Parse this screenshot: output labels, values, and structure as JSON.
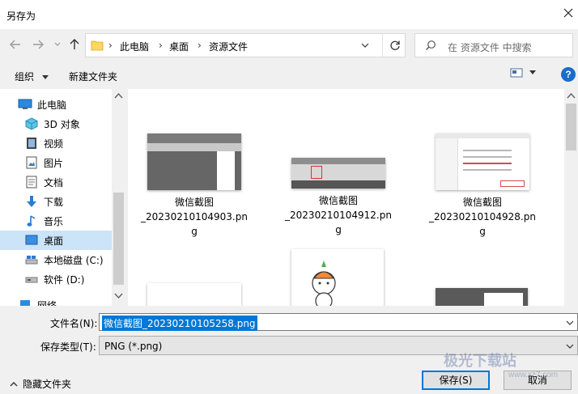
{
  "window": {
    "title": "另存为"
  },
  "address": {
    "crumbs": [
      "此电脑",
      "桌面",
      "资源文件"
    ]
  },
  "search": {
    "placeholder": "在 资源文件 中搜索"
  },
  "toolbar": {
    "organize": "组织",
    "new_folder": "新建文件夹",
    "help": "?"
  },
  "sidebar": {
    "items": [
      {
        "label": "此电脑",
        "icon": "computer-icon"
      },
      {
        "label": "3D 对象",
        "icon": "3d-objects-icon"
      },
      {
        "label": "视频",
        "icon": "video-icon"
      },
      {
        "label": "图片",
        "icon": "pictures-icon"
      },
      {
        "label": "文档",
        "icon": "documents-icon"
      },
      {
        "label": "下载",
        "icon": "download-icon"
      },
      {
        "label": "音乐",
        "icon": "music-icon"
      },
      {
        "label": "桌面",
        "icon": "desktop-icon",
        "selected": true
      },
      {
        "label": "本地磁盘 (C:)",
        "icon": "drive-c-icon"
      },
      {
        "label": "软件 (D:)",
        "icon": "drive-d-icon"
      },
      {
        "label": "网络",
        "icon": "network-icon"
      }
    ]
  },
  "files": [
    {
      "line1": "微信截图",
      "line2": "_20230210104903.pn",
      "line3": "g"
    },
    {
      "line1": "微信截图",
      "line2": "_20230210104912.pn",
      "line3": "g"
    },
    {
      "line1": "微信截图",
      "line2": "_20230210104928.pn",
      "line3": "g"
    }
  ],
  "form": {
    "filename_label": "文件名(N):",
    "filename_value": "微信截图_20230210105258.png",
    "filetype_label": "保存类型(T):",
    "filetype_value": "PNG (*.png)",
    "hide_folders": "隐藏文件夹",
    "save": "保存(S)",
    "cancel": "取消"
  },
  "watermark": {
    "text": "极光下载站",
    "url": "www.xz7.com"
  },
  "colors": {
    "accent": "#0078d7",
    "selected_row": "#cce4f7",
    "folder": "#ffd75e"
  }
}
